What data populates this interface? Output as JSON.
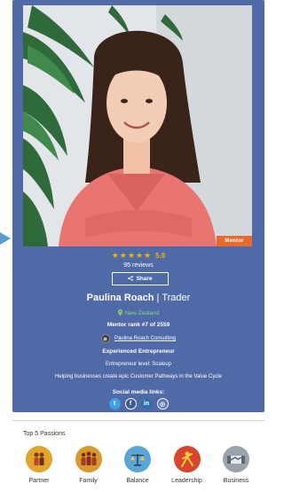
{
  "profile": {
    "badge": "Mentor",
    "rating": {
      "stars": "★★★★★",
      "value": "5.0",
      "reviews": "95 reviews"
    },
    "share_label": "Share",
    "name": "Paulina Roach",
    "separator": "|",
    "role": "Trader",
    "location": "New Zealand",
    "mentor_rank": "Mentor rank #7 of 2559",
    "company": "Paulina Roach Consulting",
    "headline": "Experienced Entrepreneur",
    "level": "Entrepreneur level: Scaleup",
    "tagline": "Helping businesses create epic Customer Pathways in the Value Cycle",
    "social_title": "Social media links:",
    "social": [
      {
        "name": "twitter",
        "glyph": "t"
      },
      {
        "name": "facebook",
        "glyph": "f"
      },
      {
        "name": "linkedin",
        "glyph": "in"
      },
      {
        "name": "website",
        "glyph": "◎"
      }
    ]
  },
  "passions": {
    "title": "Top 5 Passions",
    "items": [
      {
        "label": "Partner",
        "icon": "partner-icon",
        "color": "#e0a52a"
      },
      {
        "label": "Family",
        "icon": "family-icon",
        "color": "#d89a2c"
      },
      {
        "label": "Balance",
        "icon": "balance-icon",
        "color": "#5aa6d6"
      },
      {
        "label": "Leadership",
        "icon": "leadership-icon",
        "color": "#d9442f"
      },
      {
        "label": "Business",
        "icon": "business-icon",
        "color": "#9aa3ad"
      }
    ]
  },
  "colors": {
    "card": "#4f6aa6",
    "badge": "#e76a2c",
    "star": "#f4b400",
    "location": "#8fd47a"
  }
}
